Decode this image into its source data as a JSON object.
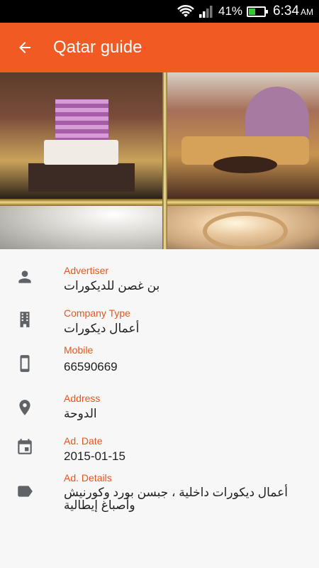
{
  "status_bar": {
    "battery_percent": "41%",
    "time": "6:34",
    "ampm": "AM",
    "battery_level": 0.41
  },
  "app_bar": {
    "title": "Qatar guide",
    "back_icon": "arrow-back-icon"
  },
  "details": [
    {
      "icon": "person-icon",
      "label": "Advertiser",
      "value": "بن غصن للديكورات"
    },
    {
      "icon": "building-icon",
      "label": "Company Type",
      "value": "أعمال ديكورات"
    },
    {
      "icon": "phone-icon",
      "label": "Mobile",
      "value": "66590669"
    },
    {
      "icon": "location-pin-icon",
      "label": "Address",
      "value": "الدوحة"
    },
    {
      "icon": "calendar-icon",
      "label": "Ad. Date",
      "value": "2015-01-15"
    },
    {
      "icon": "tag-icon",
      "label": "Ad. Details",
      "value": "أعمال ديكورات داخلية ، جبسن بورد وكورنيش وأصباغ إيطالية"
    }
  ],
  "colors": {
    "accent": "#f15a22",
    "label": "#e8541c",
    "icon": "#5f6368"
  }
}
